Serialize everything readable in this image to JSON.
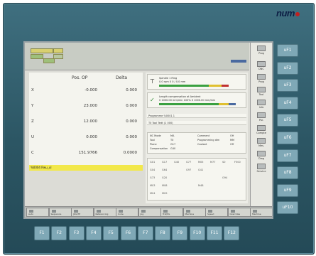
{
  "brand": "num",
  "colors": {
    "bezel": "#2c5664",
    "screen": "#dcdcd6",
    "key": "#7fa8b6",
    "highlight": "#f2e84a",
    "gauge_green": "#3aa040",
    "gauge_yellow": "#e0c030",
    "gauge_red": "#c03030",
    "brand_mark": "#c02020"
  },
  "positions": {
    "header_pos": "Pos. OP",
    "header_delta": "Delta",
    "rows": [
      {
        "axis": "X",
        "pos": "-0.000",
        "delta": "0.000"
      },
      {
        "axis": "Y",
        "pos": "23.000",
        "delta": "0.000"
      },
      {
        "axis": "Z",
        "pos": "12.000",
        "delta": "0.000"
      },
      {
        "axis": "U",
        "pos": "0.000",
        "delta": "0.000"
      },
      {
        "axis": "C",
        "pos": "151.9766",
        "delta": "0.0000"
      }
    ]
  },
  "yellow_line": "%0004 Rwu_ul",
  "right_panel": {
    "msg1": {
      "icon": "tool-icon",
      "l1": "Spindle 1 Ring",
      "l2": "0.0 rpm    0 0 / 0.0 mm"
    },
    "msg2": {
      "icon": "check-icon",
      "l1": "Length compensation at Ambient",
      "l2": "0 1000.00 mm/min    100% 0 1000.00 mm/min"
    },
    "prog": "Programme %0001 1",
    "tool": "T0 Tool Tedt (1 000)",
    "info": [
      "NC Mode",
      "Tool",
      "Plane",
      "Compensation",
      "Comment",
      "Programming dim",
      "Coolant"
    ],
    "info_vals": [
      "MA",
      "T0",
      "G17",
      "G40",
      "OH",
      "MM",
      "Off"
    ],
    "grid_rows": [
      [
        "G01",
        "G17",
        "G40",
        "G77",
        "M05",
        "M77",
        "S0",
        "F500"
      ],
      [
        "G04",
        "G64",
        "",
        "G97",
        "G41",
        "",
        "",
        ""
      ],
      [
        "G73",
        "G20",
        "",
        "",
        "",
        "",
        "G94",
        ""
      ],
      [
        "M03",
        "M08",
        "",
        "",
        "M48",
        "",
        "",
        ""
      ],
      [
        "M04",
        "M09",
        "",
        "",
        "",
        "",
        "",
        ""
      ]
    ]
  },
  "vsidebar": [
    "Prog",
    "DNC",
    "Prog",
    "Tool",
    "Info",
    "Par.",
    "Compte",
    "Mes.",
    "Diag",
    "Service"
  ],
  "softkeys": [
    "Auto",
    "Sequence",
    "JOG/TP",
    "Referencing",
    "Code",
    "Jog",
    "Trsf/DL",
    "Machine",
    "Speed",
    "Overrides",
    "Machine"
  ],
  "side_keys": [
    "uF1",
    "uF2",
    "uF3",
    "uF4",
    "uF5",
    "uF6",
    "uF7",
    "uF8",
    "uF9",
    "uF10"
  ],
  "bottom_keys": [
    "F1",
    "F2",
    "F3",
    "F4",
    "F5",
    "F6",
    "F7",
    "F8",
    "F9",
    "F10",
    "F11",
    "F12"
  ]
}
